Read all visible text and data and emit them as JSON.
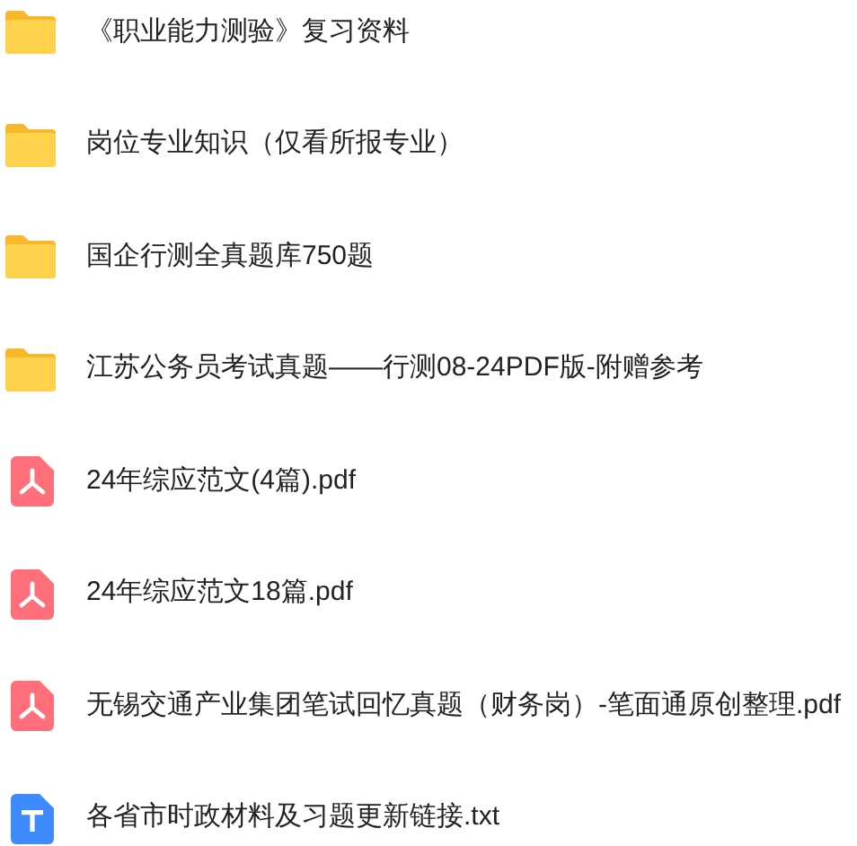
{
  "files": [
    {
      "kind": "folder",
      "name": "《职业能力测验》复习资料"
    },
    {
      "kind": "folder",
      "name": "岗位专业知识（仅看所报专业）"
    },
    {
      "kind": "folder",
      "name": "国企行测全真题库750题"
    },
    {
      "kind": "folder",
      "name": "江苏公务员考试真题——行测08-24PDF版-附赠参考"
    },
    {
      "kind": "pdf",
      "name": "24年综应范文(4篇).pdf"
    },
    {
      "kind": "pdf",
      "name": "24年综应范文18篇.pdf"
    },
    {
      "kind": "pdf",
      "name": "无锡交通产业集团笔试回忆真题（财务岗）-笔面通原创整理.pdf"
    },
    {
      "kind": "txt",
      "name": "各省市时政材料及习题更新链接.txt"
    }
  ]
}
